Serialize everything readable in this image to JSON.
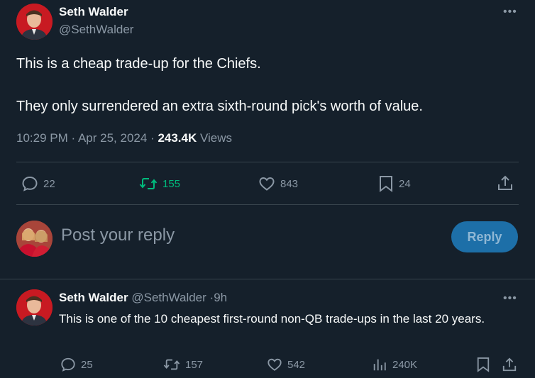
{
  "main_tweet": {
    "author_name": "Seth Walder",
    "author_handle": "@SethWalder",
    "text_line1": "This is a cheap trade-up for the Chiefs.",
    "text_line2": "They only surrendered an extra sixth-round pick's worth of value.",
    "time": "10:29 PM",
    "date": "Apr 25, 2024",
    "views_count": "243.4K",
    "views_label": "Views",
    "replies": "22",
    "retweets": "155",
    "likes": "843",
    "bookmarks": "24"
  },
  "reply_box": {
    "placeholder": "Post your reply",
    "button_label": "Reply"
  },
  "second_tweet": {
    "author_name": "Seth Walder",
    "author_handle": "@SethWalder",
    "age": "9h",
    "text": "This is one of the 10 cheapest first-round non-QB trade-ups in the last 20 years.",
    "replies": "25",
    "retweets": "157",
    "likes": "542",
    "views": "240K"
  },
  "colors": {
    "background": "#15202b",
    "retweet_green": "#00ba7c",
    "reply_button": "#1d6fa8",
    "muted_text": "#8b98a5"
  },
  "icons": [
    "more-icon",
    "reply-icon",
    "retweet-icon",
    "like-icon",
    "bookmark-icon",
    "share-icon",
    "views-icon"
  ]
}
